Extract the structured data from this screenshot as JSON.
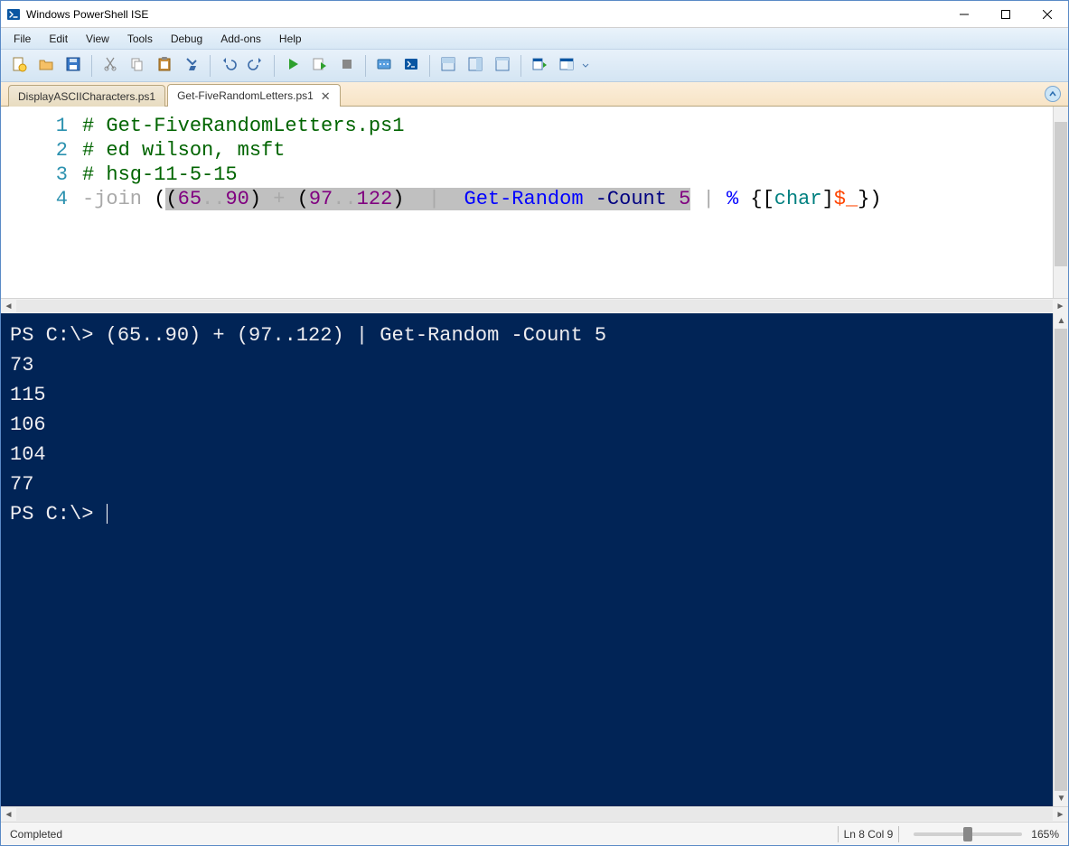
{
  "window": {
    "title": "Windows PowerShell ISE"
  },
  "menubar": {
    "items": [
      "File",
      "Edit",
      "View",
      "Tools",
      "Debug",
      "Add-ons",
      "Help"
    ]
  },
  "toolbar": {
    "buttons": [
      {
        "name": "new-file",
        "group": 0
      },
      {
        "name": "open-file",
        "group": 0
      },
      {
        "name": "save-file",
        "group": 0
      },
      {
        "name": "cut",
        "group": 1
      },
      {
        "name": "copy",
        "group": 1
      },
      {
        "name": "paste",
        "group": 1
      },
      {
        "name": "clear",
        "group": 1
      },
      {
        "name": "undo",
        "group": 2
      },
      {
        "name": "redo",
        "group": 2
      },
      {
        "name": "run-script",
        "group": 3
      },
      {
        "name": "run-selection",
        "group": 3
      },
      {
        "name": "stop",
        "group": 3
      },
      {
        "name": "remote-powershell",
        "group": 4
      },
      {
        "name": "powershell-console",
        "group": 4
      },
      {
        "name": "show-script-top",
        "group": 5
      },
      {
        "name": "show-script-right",
        "group": 5
      },
      {
        "name": "show-script-max",
        "group": 5
      },
      {
        "name": "show-command",
        "group": 6
      },
      {
        "name": "show-command-addon",
        "group": 6
      }
    ]
  },
  "tabs": {
    "items": [
      {
        "label": "DisplayASCIICharacters.ps1",
        "active": false
      },
      {
        "label": "Get-FiveRandomLetters.ps1",
        "active": true
      }
    ]
  },
  "editor": {
    "lines": [
      {
        "num": "1",
        "tokens": [
          {
            "t": "# Get-FiveRandomLetters.ps1",
            "c": "c-comment"
          }
        ]
      },
      {
        "num": "2",
        "tokens": [
          {
            "t": "# ed wilson, msft",
            "c": "c-comment"
          }
        ]
      },
      {
        "num": "3",
        "tokens": [
          {
            "t": "# hsg-11-5-15",
            "c": "c-comment"
          }
        ]
      },
      {
        "num": "4",
        "tokens": [
          {
            "t": "-join",
            "c": "c-op"
          },
          {
            "t": " ",
            "c": ""
          },
          {
            "t": "(",
            "c": ""
          },
          {
            "t": "(",
            "c": "c-hl"
          },
          {
            "t": "65",
            "c": "c-num c-hl"
          },
          {
            "t": "..",
            "c": "c-op c-hl"
          },
          {
            "t": "90",
            "c": "c-num c-hl"
          },
          {
            "t": ") ",
            "c": "c-hl"
          },
          {
            "t": "+",
            "c": "c-op c-hl"
          },
          {
            "t": " (",
            "c": "c-hl"
          },
          {
            "t": "97",
            "c": "c-num c-hl"
          },
          {
            "t": "..",
            "c": "c-op c-hl"
          },
          {
            "t": "122",
            "c": "c-num c-hl"
          },
          {
            "t": ")",
            "c": "c-hl"
          },
          {
            "t": "  ",
            "c": "c-hl"
          },
          {
            "t": "|",
            "c": "c-op c-hl"
          },
          {
            "t": "  ",
            "c": "c-hl"
          },
          {
            "t": "Get-Random",
            "c": "c-cmd c-hl"
          },
          {
            "t": " ",
            "c": "c-hl"
          },
          {
            "t": "-Count",
            "c": "c-param c-hl"
          },
          {
            "t": " ",
            "c": "c-hl"
          },
          {
            "t": "5",
            "c": "c-num c-hl"
          },
          {
            "t": " ",
            "c": ""
          },
          {
            "t": "|",
            "c": "c-op"
          },
          {
            "t": " ",
            "c": ""
          },
          {
            "t": "%",
            "c": "c-cmd"
          },
          {
            "t": " {",
            "c": ""
          },
          {
            "t": "[",
            "c": ""
          },
          {
            "t": "char",
            "c": "c-type"
          },
          {
            "t": "]",
            "c": ""
          },
          {
            "t": "$_",
            "c": "c-var"
          },
          {
            "t": "})",
            "c": ""
          }
        ]
      }
    ]
  },
  "console": {
    "lines": [
      "PS C:\\> (65..90) + (97..122) | Get-Random -Count 5",
      "73",
      "115",
      "106",
      "104",
      "77",
      "",
      "PS C:\\> "
    ],
    "prompt_cursor": true
  },
  "statusbar": {
    "status": "Completed",
    "cursor": "Ln 8  Col 9",
    "zoom": "165%"
  }
}
